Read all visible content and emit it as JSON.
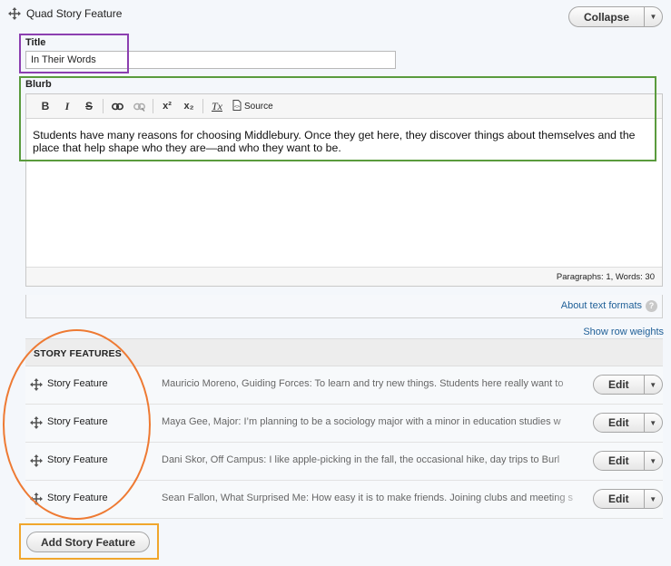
{
  "paragraph": {
    "title": "Quad Story Feature",
    "collapse_label": "Collapse"
  },
  "title_field": {
    "label": "Title",
    "value": "In Their Words"
  },
  "blurb": {
    "label": "Blurb",
    "toolbar": {
      "bold": "B",
      "italic": "I",
      "strike": "S",
      "superscript": "x²",
      "subscript": "x₂",
      "remove_format": "Tx",
      "source": "Source"
    },
    "content": "Students have many reasons for choosing Middlebury. Once they get here, they discover things about themselves and the place that help shape who they are—and who they want to be.",
    "status": "Paragraphs: 1, Words: 30"
  },
  "formats_link": "About text formats",
  "formats_help": "?",
  "show_row_weights": "Show row weights",
  "story_features": {
    "heading": "STORY FEATURES",
    "rows": [
      {
        "name": "Story Feature",
        "summary": "Mauricio Moreno, Guiding Forces: To learn and try new things. Students here really want to",
        "edit": "Edit"
      },
      {
        "name": "Story Feature",
        "summary": "Maya Gee, Major: I’m planning to be a sociology major with a minor in education studies w",
        "edit": "Edit"
      },
      {
        "name": "Story Feature",
        "summary": "Dani Skor, Off Campus: I like apple-picking in the fall, the occasional hike, day trips to Burl",
        "edit": "Edit"
      },
      {
        "name": "Story Feature",
        "summary": "Sean Fallon, What Surprised Me: How easy it is to make friends. Joining clubs and meeting s",
        "edit": "Edit"
      }
    ]
  },
  "add_button": "Add Story Feature",
  "colors": {
    "link": "#1f5f97",
    "highlight_purple": "#8c3fb0",
    "highlight_green": "#5a9b3d",
    "highlight_orange": "#ee7a33",
    "highlight_yellow": "#f0a62c"
  },
  "icons": {
    "drag": "move-cross-icon",
    "caret": "caret-down-icon",
    "link": "link-icon",
    "unlink": "unlink-icon",
    "source": "source-icon",
    "help": "help-icon"
  }
}
